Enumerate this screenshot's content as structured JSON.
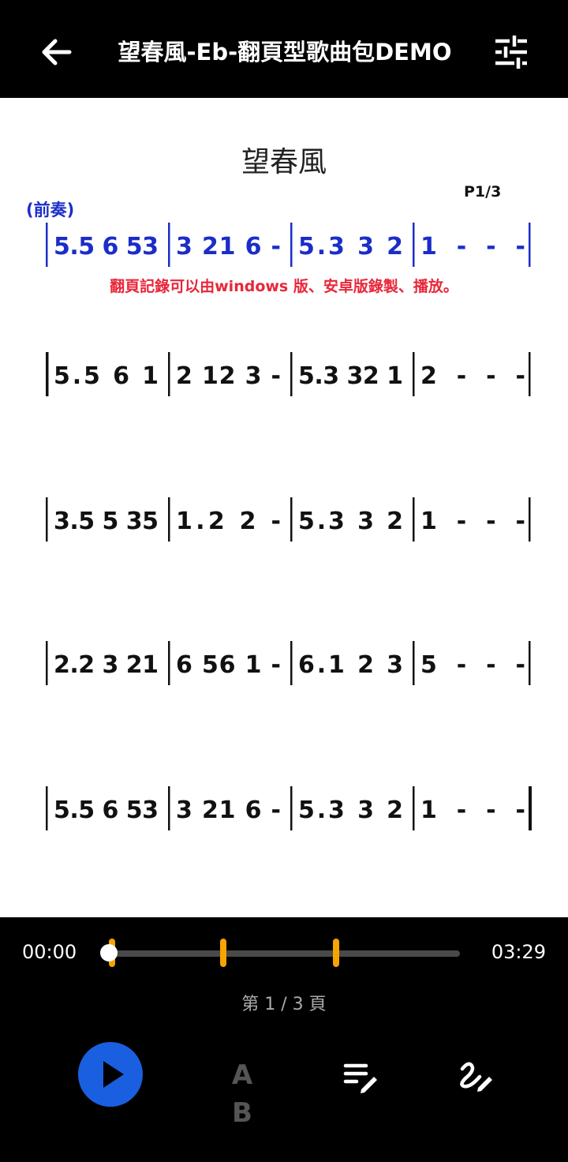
{
  "header": {
    "title": "望春風-Eb-翻頁型歌曲包DEMO",
    "back_icon": "arrow-left-icon",
    "settings_icon": "tune-icon"
  },
  "sheet": {
    "song_title": "望春風",
    "page_marker": "P1/3",
    "intro_label": "(前奏)",
    "note": "翻頁記錄可以由windows 版、安卓版錄製、播放。",
    "lines": [
      {
        "color": "#1b2dc8",
        "measures": [
          "5.5 6 53",
          "3 21 6 -",
          "5.3 3 2",
          "1 - - -"
        ]
      },
      {
        "color": "#111111",
        "measures": [
          "5.5 6 1",
          "2 12 3 -",
          "5.3 32 1",
          "2 - - -"
        ]
      },
      {
        "color": "#111111",
        "measures": [
          "3.5 5 35",
          "1.2 2 -",
          "5.3 3 2",
          "1 - - -"
        ]
      },
      {
        "color": "#111111",
        "measures": [
          "2.2 3 21",
          "6 56 1 -",
          "6.1 2 3",
          "5 - - -"
        ]
      },
      {
        "color": "#111111",
        "measures": [
          "5.5 6 53",
          "3 21 6 -",
          "5.3 3 2",
          "1 - - -"
        ]
      }
    ]
  },
  "player": {
    "current_time": "00:00",
    "total_time": "03:29",
    "progress": 0,
    "page_markers": [
      0.01,
      0.325,
      0.647
    ],
    "page_indicator": "第 1 / 3 頁",
    "ab_label": "A B",
    "accent_color": "#1a5fe0",
    "marker_color": "#f5a400"
  }
}
